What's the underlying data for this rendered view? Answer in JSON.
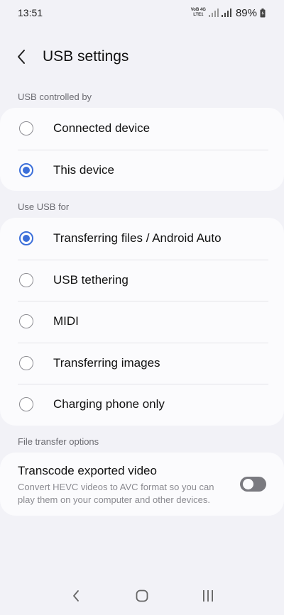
{
  "status_bar": {
    "time": "13:51",
    "network_top": "VoB 4G",
    "network_bottom": "LTE1",
    "battery_percent": "89%",
    "icons": [
      "signal-icon",
      "signal-icon",
      "battery-icon"
    ]
  },
  "header": {
    "title": "USB settings",
    "back_icon": "chevron-left-icon"
  },
  "usb_controlled_by": {
    "label": "USB controlled by",
    "options": [
      {
        "label": "Connected device",
        "selected": false
      },
      {
        "label": "This device",
        "selected": true
      }
    ]
  },
  "use_usb_for": {
    "label": "Use USB for",
    "options": [
      {
        "label": "Transferring files / Android Auto",
        "selected": true
      },
      {
        "label": "USB tethering",
        "selected": false
      },
      {
        "label": "MIDI",
        "selected": false
      },
      {
        "label": "Transferring images",
        "selected": false
      },
      {
        "label": "Charging phone only",
        "selected": false
      }
    ]
  },
  "file_transfer_options": {
    "label": "File transfer options",
    "transcode": {
      "title": "Transcode exported video",
      "description": "Convert HEVC videos to AVC format so you can play them on your computer and other devices.",
      "enabled": false
    }
  },
  "nav_bar": {
    "icons": [
      "back-nav-icon",
      "home-nav-icon",
      "recents-nav-icon"
    ]
  },
  "colors": {
    "accent": "#3c6fd9",
    "background": "#f2f2f7",
    "card": "#fbfbfd"
  }
}
